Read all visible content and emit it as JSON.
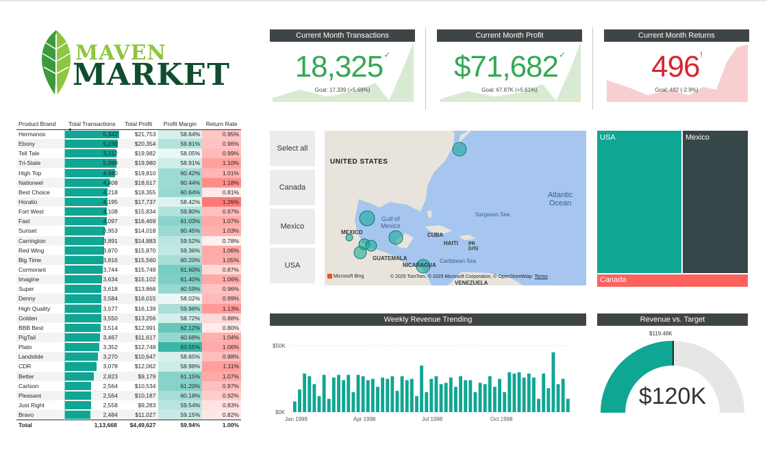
{
  "logo": {
    "line1": "MAVEN",
    "line2": "MARKET"
  },
  "kpis": [
    {
      "title": "Current Month Transactions",
      "value": "18,325",
      "indicator": "✓",
      "goal": "Goal: 17,339 (+5.69%)",
      "status": "good",
      "color": "#34a853",
      "spark_color": "#d9ead3"
    },
    {
      "title": "Current Month Profit",
      "value": "$71,682",
      "indicator": "✓",
      "goal": "Goal: 67.87K (+5.61%)",
      "status": "good",
      "color": "#34a853",
      "spark_color": "#d9ead3"
    },
    {
      "title": "Current Month Returns",
      "value": "496",
      "indicator": "!",
      "goal": "Goal: 482 (-2.9%)",
      "status": "bad",
      "color": "#d9252d",
      "spark_color": "#f8cfd0"
    }
  ],
  "table": {
    "headers": [
      "Product Brand",
      "Total Transactions",
      "Total Profit",
      "Profit Margin",
      "Return Rate"
    ],
    "max_transactions": 5342,
    "rows": [
      {
        "brand": "Hermanos",
        "txn": "5,342",
        "txn_n": 5342,
        "profit": "$21,753",
        "margin": "58.64%",
        "margin_n": 58.64,
        "ret": "0.95%",
        "ret_n": 0.95
      },
      {
        "brand": "Ebony",
        "txn": "5,238",
        "txn_n": 5238,
        "profit": "$20,354",
        "margin": "59.81%",
        "margin_n": 59.81,
        "ret": "0.96%",
        "ret_n": 0.96
      },
      {
        "brand": "Tell Tale",
        "txn": "5,112",
        "txn_n": 5112,
        "profit": "$19,982",
        "margin": "58.05%",
        "margin_n": 58.05,
        "ret": "0.99%",
        "ret_n": 0.99
      },
      {
        "brand": "Tri-State",
        "txn": "5,099",
        "txn_n": 5099,
        "profit": "$19,980",
        "margin": "58.91%",
        "margin_n": 58.91,
        "ret": "1.10%",
        "ret_n": 1.1
      },
      {
        "brand": "High Top",
        "txn": "4,940",
        "txn_n": 4940,
        "profit": "$19,810",
        "margin": "60.42%",
        "margin_n": 60.42,
        "ret": "1.01%",
        "ret_n": 1.01
      },
      {
        "brand": "Nationeel",
        "txn": "4,408",
        "txn_n": 4408,
        "profit": "$18,617",
        "margin": "60.44%",
        "margin_n": 60.44,
        "ret": "1.18%",
        "ret_n": 1.18
      },
      {
        "brand": "Best Choice",
        "txn": "4,218",
        "txn_n": 4218,
        "profit": "$18,355",
        "margin": "60.64%",
        "margin_n": 60.64,
        "ret": "0.81%",
        "ret_n": 0.81
      },
      {
        "brand": "Horatio",
        "txn": "4,195",
        "txn_n": 4195,
        "profit": "$17,737",
        "margin": "58.42%",
        "margin_n": 58.42,
        "ret": "1.26%",
        "ret_n": 1.26
      },
      {
        "brand": "Fort West",
        "txn": "4,108",
        "txn_n": 4108,
        "profit": "$15,834",
        "margin": "59.80%",
        "margin_n": 59.8,
        "ret": "0.97%",
        "ret_n": 0.97
      },
      {
        "brand": "Fast",
        "txn": "4,097",
        "txn_n": 4097,
        "profit": "$16,469",
        "margin": "61.03%",
        "margin_n": 61.03,
        "ret": "1.07%",
        "ret_n": 1.07
      },
      {
        "brand": "Sunset",
        "txn": "3,953",
        "txn_n": 3953,
        "profit": "$14,018",
        "margin": "60.45%",
        "margin_n": 60.45,
        "ret": "1.03%",
        "ret_n": 1.03
      },
      {
        "brand": "Carrington",
        "txn": "3,891",
        "txn_n": 3891,
        "profit": "$14,883",
        "margin": "59.52%",
        "margin_n": 59.52,
        "ret": "0.78%",
        "ret_n": 0.78
      },
      {
        "brand": "Red Wing",
        "txn": "3,870",
        "txn_n": 3870,
        "profit": "$15,870",
        "margin": "59.36%",
        "margin_n": 59.36,
        "ret": "1.06%",
        "ret_n": 1.06
      },
      {
        "brand": "Big Time",
        "txn": "3,816",
        "txn_n": 3816,
        "profit": "$15,560",
        "margin": "60.20%",
        "margin_n": 60.2,
        "ret": "1.05%",
        "ret_n": 1.05
      },
      {
        "brand": "Cormorant",
        "txn": "3,744",
        "txn_n": 3744,
        "profit": "$15,749",
        "margin": "61.60%",
        "margin_n": 61.6,
        "ret": "0.87%",
        "ret_n": 0.87
      },
      {
        "brand": "Imagine",
        "txn": "3,634",
        "txn_n": 3634,
        "profit": "$15,102",
        "margin": "61.40%",
        "margin_n": 61.4,
        "ret": "1.06%",
        "ret_n": 1.06
      },
      {
        "brand": "Super",
        "txn": "3,618",
        "txn_n": 3618,
        "profit": "$13,868",
        "margin": "60.59%",
        "margin_n": 60.59,
        "ret": "0.96%",
        "ret_n": 0.96
      },
      {
        "brand": "Denny",
        "txn": "3,584",
        "txn_n": 3584,
        "profit": "$16,015",
        "margin": "58.02%",
        "margin_n": 58.02,
        "ret": "0.99%",
        "ret_n": 0.99
      },
      {
        "brand": "High Quality",
        "txn": "3,577",
        "txn_n": 3577,
        "profit": "$16,139",
        "margin": "59.98%",
        "margin_n": 59.98,
        "ret": "1.13%",
        "ret_n": 1.13
      },
      {
        "brand": "Golden",
        "txn": "3,550",
        "txn_n": 3550,
        "profit": "$13,256",
        "margin": "58.72%",
        "margin_n": 58.72,
        "ret": "0.88%",
        "ret_n": 0.88
      },
      {
        "brand": "BBB Best",
        "txn": "3,514",
        "txn_n": 3514,
        "profit": "$12,991",
        "margin": "62.12%",
        "margin_n": 62.12,
        "ret": "0.80%",
        "ret_n": 0.8
      },
      {
        "brand": "PigTail",
        "txn": "3,467",
        "txn_n": 3467,
        "profit": "$11,617",
        "margin": "60.68%",
        "margin_n": 60.68,
        "ret": "1.04%",
        "ret_n": 1.04
      },
      {
        "brand": "Plato",
        "txn": "3,352",
        "txn_n": 3352,
        "profit": "$12,748",
        "margin": "63.55%",
        "margin_n": 63.55,
        "ret": "1.06%",
        "ret_n": 1.06
      },
      {
        "brand": "Landslide",
        "txn": "3,270",
        "txn_n": 3270,
        "profit": "$10,647",
        "margin": "58.65%",
        "margin_n": 58.65,
        "ret": "0.98%",
        "ret_n": 0.98
      },
      {
        "brand": "CDR",
        "txn": "3,078",
        "txn_n": 3078,
        "profit": "$12,062",
        "margin": "58.98%",
        "margin_n": 58.98,
        "ret": "1.11%",
        "ret_n": 1.11
      },
      {
        "brand": "Better",
        "txn": "2,823",
        "txn_n": 2823,
        "profit": "$9,179",
        "margin": "61.15%",
        "margin_n": 61.15,
        "ret": "1.07%",
        "ret_n": 1.07
      },
      {
        "brand": "Carlson",
        "txn": "2,564",
        "txn_n": 2564,
        "profit": "$10,534",
        "margin": "61.20%",
        "margin_n": 61.2,
        "ret": "0.97%",
        "ret_n": 0.97
      },
      {
        "brand": "Pleasant",
        "txn": "2,564",
        "txn_n": 2564,
        "profit": "$10,187",
        "margin": "60.18%",
        "margin_n": 60.18,
        "ret": "0.92%",
        "ret_n": 0.92
      },
      {
        "brand": "Just Right",
        "txn": "2,558",
        "txn_n": 2558,
        "profit": "$9,283",
        "margin": "59.54%",
        "margin_n": 59.54,
        "ret": "0.83%",
        "ret_n": 0.83
      },
      {
        "brand": "Bravo",
        "txn": "2,484",
        "txn_n": 2484,
        "profit": "$11,027",
        "margin": "59.15%",
        "margin_n": 59.15,
        "ret": "0.82%",
        "ret_n": 0.82
      }
    ],
    "total": {
      "label": "Total",
      "txn": "1,13,668",
      "profit": "$4,49,627",
      "margin": "59.94%",
      "ret": "1.00%"
    }
  },
  "slicer": {
    "items": [
      "Select all",
      "Canada",
      "Mexico",
      "USA"
    ]
  },
  "map": {
    "labels": {
      "us": "UNITED STATES",
      "mexico": "MEXICO",
      "atlantic1": "Atlantic",
      "atlantic2": "Ocean",
      "gulf1": "Gulf of",
      "gulf2": "Mexico",
      "sargasso": "Sargasso Sea",
      "cuba": "CUBA",
      "haiti": "HAITI",
      "pr1": "PR",
      "pr2": "(US)",
      "guatemala": "GUATEMALA",
      "nicaragua": "NICARAGUA",
      "caribbean": "Caribbean Sea",
      "venezuela": "VENEZUELA"
    },
    "attribution": "© 2025 TomTom, © 2025 Microsoft Corporation, © OpenStreetMap",
    "terms": "Terms",
    "bing": "Microsoft Bing"
  },
  "treemap": {
    "usa": "USA",
    "mexico": "Mexico",
    "canada": "Canada",
    "colors": {
      "usa": "#0fa693",
      "mexico": "#374649",
      "canada": "#fd625e"
    }
  },
  "weekly": {
    "title": "Weekly Revenue Trending",
    "yticks": [
      "$50K",
      "$0K"
    ],
    "xticks": [
      "Jan 1998",
      "Apr 1998",
      "Jul 1998",
      "Oct 1998"
    ]
  },
  "gauge": {
    "title": "Revenue vs. Target",
    "target_label": "$119.48K",
    "value": "$120K",
    "fill_fraction": 1.0
  },
  "chart_data": {
    "type": "bar",
    "title": "Weekly Revenue Trending",
    "ylim": [
      0,
      55000
    ],
    "color": "#0fa693",
    "values": [
      8000,
      17000,
      29000,
      27000,
      21000,
      12000,
      28000,
      10000,
      26000,
      28000,
      24000,
      28000,
      15000,
      28000,
      27000,
      24000,
      25000,
      19000,
      26000,
      25000,
      27000,
      16000,
      27000,
      24000,
      25000,
      12000,
      35000,
      15000,
      25000,
      27000,
      21000,
      22000,
      26000,
      19000,
      27000,
      24000,
      24000,
      15000,
      22000,
      21000,
      27000,
      19000,
      25000,
      15000,
      30000,
      29000,
      30000,
      26000,
      29000,
      26000,
      10000,
      29000,
      18000,
      45000,
      21000,
      25000,
      10000
    ]
  }
}
